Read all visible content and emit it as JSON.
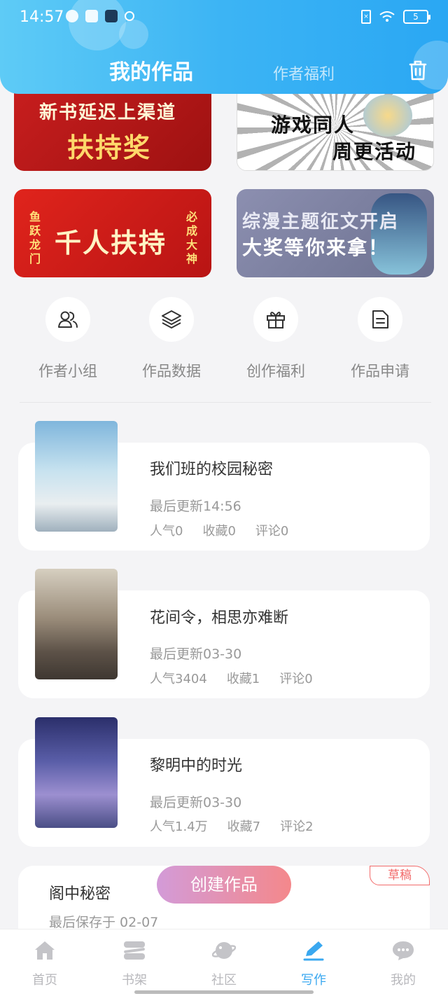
{
  "status_bar": {
    "time": "14:57",
    "battery": "5"
  },
  "header": {
    "tab_active": "我的作品",
    "tab_other": "作者福利"
  },
  "banners": {
    "b1": {
      "line1": "新书延迟上渠道",
      "line2": "扶持奖"
    },
    "b2": {
      "line1": "游戏同人",
      "line2": "周更活动"
    },
    "b3": {
      "main": "千人扶持",
      "left": "鱼跃龙门",
      "right": "必成大神"
    },
    "b4": {
      "line1": "综漫主题征文开启",
      "line2": "大奖等你来拿！"
    }
  },
  "shortcuts": [
    {
      "label": "作者小组",
      "icon": "users-icon"
    },
    {
      "label": "作品数据",
      "icon": "layers-icon"
    },
    {
      "label": "创作福利",
      "icon": "gift-icon"
    },
    {
      "label": "作品申请",
      "icon": "document-icon"
    }
  ],
  "works": [
    {
      "title": "我们班的校园秘密",
      "update": "最后更新14:56",
      "popularity": "人气0",
      "favorites": "收藏0",
      "comments": "评论0"
    },
    {
      "title": "花间令，相思亦难断",
      "update": "最后更新03-30",
      "popularity": "人气3404",
      "favorites": "收藏1",
      "comments": "评论0"
    },
    {
      "title": "黎明中的时光",
      "update": "最后更新03-30",
      "popularity": "人气1.4万",
      "favorites": "收藏7",
      "comments": "评论2"
    }
  ],
  "draft": {
    "title": "阁中秘密",
    "saved": "最后保存于 02-07",
    "badge": "草稿"
  },
  "create_button": "创建作品",
  "bottom_nav": [
    {
      "label": "首页",
      "icon": "home-icon"
    },
    {
      "label": "书架",
      "icon": "bookshelf-icon"
    },
    {
      "label": "社区",
      "icon": "planet-icon"
    },
    {
      "label": "写作",
      "icon": "pen-icon"
    },
    {
      "label": "我的",
      "icon": "chat-bubble-icon"
    }
  ],
  "colors": {
    "accent": "#3aa8f0",
    "header_start": "#5ecbf6",
    "header_end": "#2aa7f3",
    "draft_badge": "#f26b6b"
  }
}
